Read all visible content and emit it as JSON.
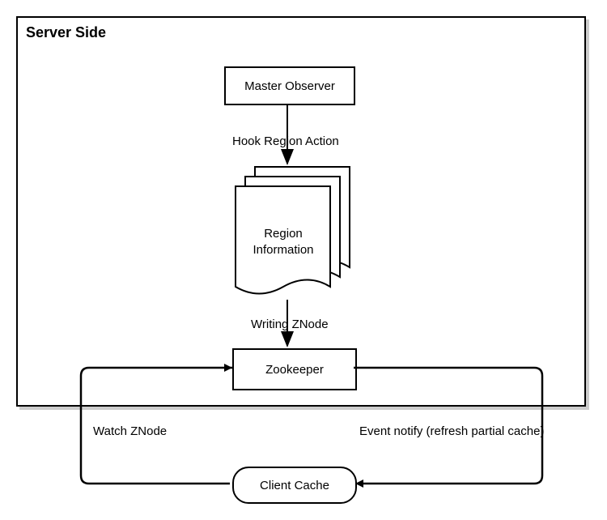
{
  "container": {
    "title": "Server Side"
  },
  "nodes": {
    "master_observer": "Master Observer",
    "region_info": "Region\nInformation",
    "zookeeper": "Zookeeper",
    "client_cache": "Client Cache"
  },
  "edges": {
    "hook": "Hook Region Action",
    "writing": "Writing ZNode",
    "watch": "Watch ZNode",
    "event": "Event notify (refresh partial cache)"
  }
}
